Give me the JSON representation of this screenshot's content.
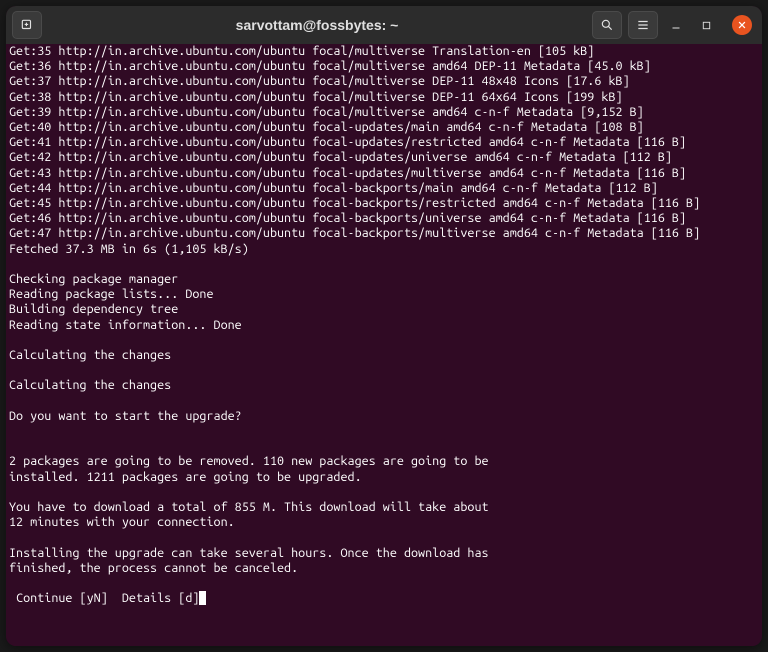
{
  "titlebar": {
    "title": "sarvottam@fossbytes: ~"
  },
  "terminal": {
    "lines": [
      "Get:35 http://in.archive.ubuntu.com/ubuntu focal/multiverse Translation-en [105 kB]",
      "Get:36 http://in.archive.ubuntu.com/ubuntu focal/multiverse amd64 DEP-11 Metadata [45.0 kB]",
      "Get:37 http://in.archive.ubuntu.com/ubuntu focal/multiverse DEP-11 48x48 Icons [17.6 kB]",
      "Get:38 http://in.archive.ubuntu.com/ubuntu focal/multiverse DEP-11 64x64 Icons [199 kB]",
      "Get:39 http://in.archive.ubuntu.com/ubuntu focal/multiverse amd64 c-n-f Metadata [9,152 B]",
      "Get:40 http://in.archive.ubuntu.com/ubuntu focal-updates/main amd64 c-n-f Metadata [108 B]",
      "Get:41 http://in.archive.ubuntu.com/ubuntu focal-updates/restricted amd64 c-n-f Metadata [116 B]",
      "Get:42 http://in.archive.ubuntu.com/ubuntu focal-updates/universe amd64 c-n-f Metadata [112 B]",
      "Get:43 http://in.archive.ubuntu.com/ubuntu focal-updates/multiverse amd64 c-n-f Metadata [116 B]",
      "Get:44 http://in.archive.ubuntu.com/ubuntu focal-backports/main amd64 c-n-f Metadata [112 B]",
      "Get:45 http://in.archive.ubuntu.com/ubuntu focal-backports/restricted amd64 c-n-f Metadata [116 B]",
      "Get:46 http://in.archive.ubuntu.com/ubuntu focal-backports/universe amd64 c-n-f Metadata [116 B]",
      "Get:47 http://in.archive.ubuntu.com/ubuntu focal-backports/multiverse amd64 c-n-f Metadata [116 B]",
      "Fetched 37.3 MB in 6s (1,105 kB/s)",
      "",
      "Checking package manager",
      "Reading package lists... Done",
      "Building dependency tree",
      "Reading state information... Done",
      "",
      "Calculating the changes",
      "",
      "Calculating the changes",
      "",
      "Do you want to start the upgrade?",
      "",
      "",
      "2 packages are going to be removed. 110 new packages are going to be",
      "installed. 1211 packages are going to be upgraded.",
      "",
      "You have to download a total of 855 M. This download will take about",
      "12 minutes with your connection.",
      "",
      "Installing the upgrade can take several hours. Once the download has",
      "finished, the process cannot be canceled.",
      ""
    ],
    "prompt": " Continue [yN]  Details [d]"
  }
}
